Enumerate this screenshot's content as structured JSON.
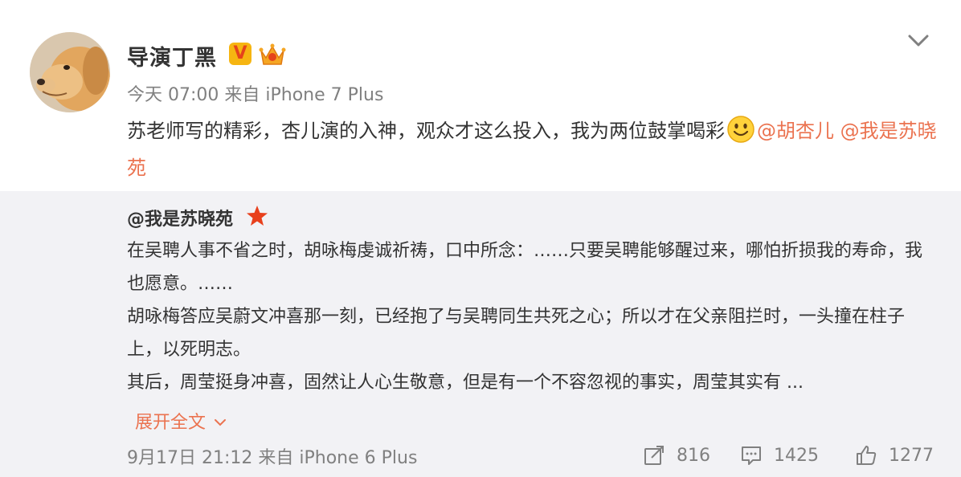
{
  "post": {
    "author_name": "导演丁黑",
    "verified_badge": "V",
    "time": "今天 07:00",
    "source": "来自 iPhone 7 Plus",
    "content_text": "苏老师写的精彩，杏儿演的入神，观众才这么投入，我为两位鼓掌喝彩",
    "emoji_icon": "smiley-emoji-icon",
    "mention_1": "@胡杏儿",
    "mention_2": "@我是苏晓苑"
  },
  "repost": {
    "author": "@我是苏晓苑",
    "paragraphs": [
      "在吴聘人事不省之时，胡咏梅虔诚祈祷，口中所念：……只要吴聘能够醒过来，哪怕折损我的寿命，我也愿意。……",
      "胡咏梅答应吴蔚文冲喜那一刻，已经抱了与吴聘同生共死之心；所以才在父亲阻拦时，一头撞在柱子上，以死明志。",
      "其后，周莹挺身冲喜，固然让人心生敬意，但是有一个不容忽视的事实，周莹其实有 ..."
    ],
    "expand_label": "展开全文",
    "meta": "9月17日 21:12 来自 iPhone 6 Plus",
    "repost_count": "816",
    "comment_count": "1425",
    "like_count": "1277"
  },
  "colors": {
    "mention": "#eb7350",
    "meta_gray": "#808080",
    "repost_bg": "#f2f2f5",
    "badge_bg": "#f6b511"
  }
}
